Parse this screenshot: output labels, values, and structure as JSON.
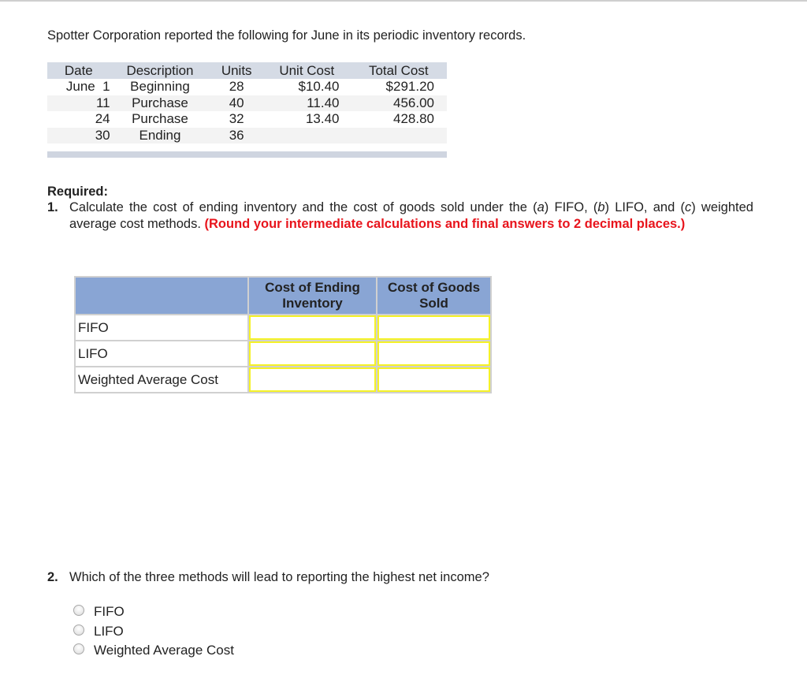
{
  "intro": "Spotter Corporation reported the following for June in its periodic inventory records.",
  "inventory_table": {
    "headers": [
      "Date",
      "Description",
      "Units",
      "Unit Cost",
      "Total Cost"
    ],
    "rows": [
      {
        "date": "June  1",
        "description": "Beginning",
        "units": "28",
        "unit_cost": "$10.40",
        "total_cost": "$291.20"
      },
      {
        "date": "11",
        "description": "Purchase",
        "units": "40",
        "unit_cost": "11.40",
        "total_cost": "456.00"
      },
      {
        "date": "24",
        "description": "Purchase",
        "units": "32",
        "unit_cost": "13.40",
        "total_cost": "428.80"
      },
      {
        "date": "30",
        "description": "Ending",
        "units": "36",
        "unit_cost": "",
        "total_cost": ""
      }
    ]
  },
  "required": {
    "title": "Required:",
    "q1_number": "1.",
    "q1_text_parts": {
      "p1": "Calculate the cost of ending inventory and the cost of goods sold under the (",
      "a": "a",
      "p2": ") FIFO, (",
      "b": "b",
      "p3": ") LIFO, and (",
      "c": "c",
      "p4": ") weighted average cost methods. "
    },
    "q1_instruction": "(Round your intermediate calculations and final answers to 2 decimal places.)"
  },
  "answer_table": {
    "headers": [
      "",
      "Cost of Ending Inventory",
      "Cost of Goods Sold"
    ],
    "rows": [
      {
        "label": "FIFO",
        "ending_inventory": "",
        "cogs": ""
      },
      {
        "label": "LIFO",
        "ending_inventory": "",
        "cogs": ""
      },
      {
        "label": "Weighted Average Cost",
        "ending_inventory": "",
        "cogs": ""
      }
    ]
  },
  "q2": {
    "number": "2.",
    "text": "Which of the three methods will lead to reporting the highest net income?",
    "options": [
      "FIFO",
      "LIFO",
      "Weighted Average Cost"
    ],
    "selected": null
  },
  "colors": {
    "header_blue": "#89a5d4",
    "input_border_yellow": "#f5f227",
    "instruction_red": "#e8141c"
  }
}
